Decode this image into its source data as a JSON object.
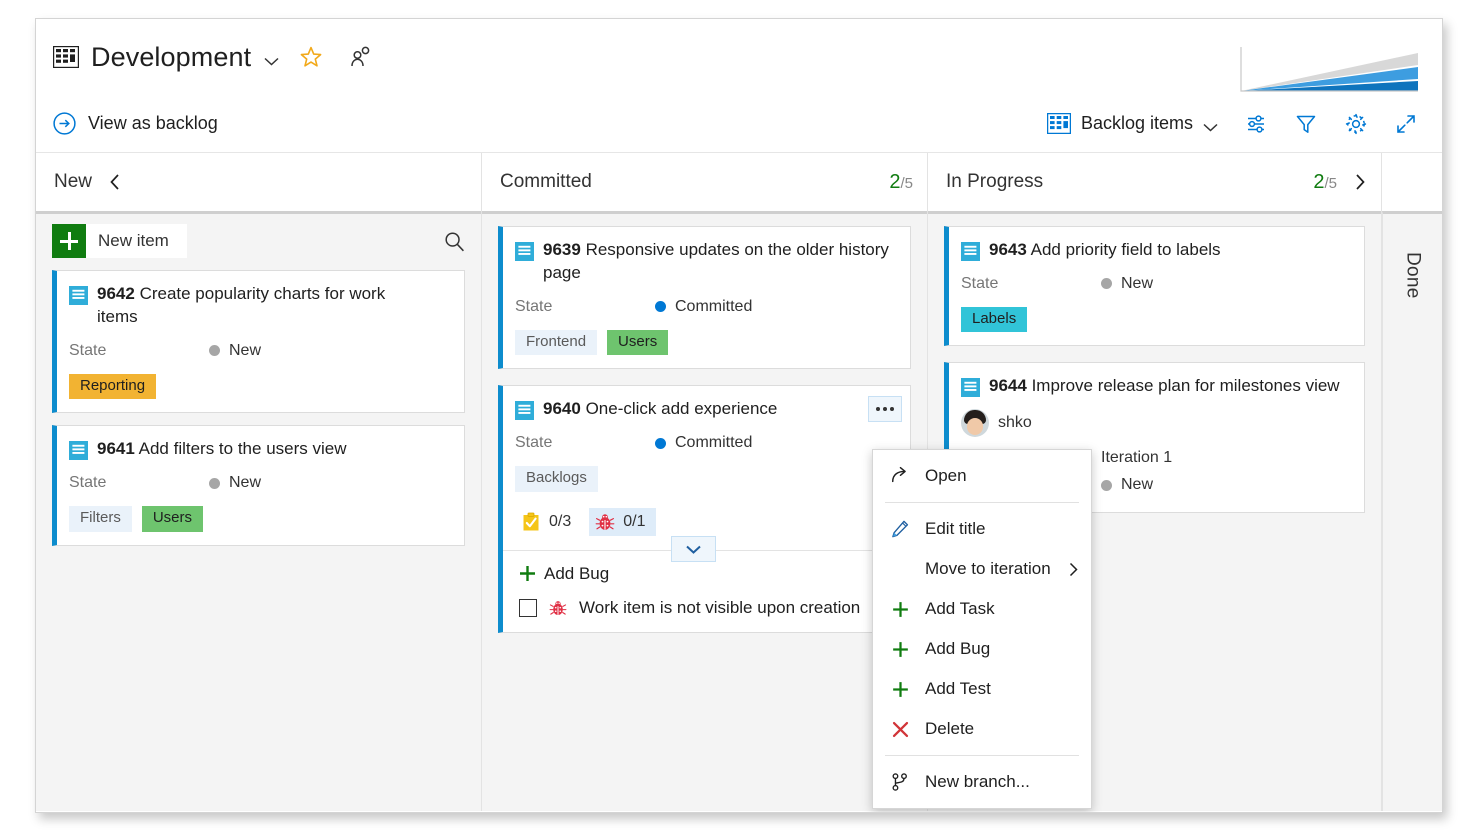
{
  "header": {
    "board_icon": "board-grid-icon",
    "title": "Development",
    "title_chevron": "chevron-down-icon",
    "favorite_icon": "star-icon",
    "team_icon": "people-icon",
    "chart_icon": "cumulative-flow-chart"
  },
  "toolbar": {
    "backlog_icon": "arrow-circle-right-icon",
    "backlog_label": "View as backlog",
    "picker_icon": "board-grid-icon",
    "picker_label": "Backlog items",
    "picker_chevron": "chevron-down-icon",
    "settings_sliders_icon": "sliders-icon",
    "filter_icon": "funnel-icon",
    "gear_icon": "gear-icon",
    "fullscreen_icon": "expand-diagonal-icon"
  },
  "board": {
    "new_item": {
      "label": "New item",
      "plus_icon": "plus-icon",
      "search_icon": "search-icon"
    },
    "columns": [
      {
        "name": "New",
        "count": "",
        "limit": "",
        "collapse_icon": "chevron-left-icon",
        "cards": [
          {
            "icon": "backlog-item-icon",
            "id": "9642",
            "title": "Create popularity charts for work items",
            "state_label": "State",
            "state_value": "New",
            "state_color": "#a6a6a6",
            "tags": [
              {
                "text": "Reporting",
                "bg": "#f2b332",
                "fg": "#1f1f1f"
              }
            ]
          },
          {
            "icon": "backlog-item-icon",
            "id": "9641",
            "title": "Add filters to the users view",
            "state_label": "State",
            "state_value": "New",
            "state_color": "#a6a6a6",
            "tags": [
              {
                "text": "Filters",
                "bg": "#eaf2fa",
                "fg": "#5a5a5a"
              },
              {
                "text": "Users",
                "bg": "#6ec46e",
                "fg": "#1f1f1f"
              }
            ]
          }
        ]
      },
      {
        "name": "Committed",
        "count": "2",
        "limit": "/5",
        "cards": [
          {
            "icon": "backlog-item-icon",
            "id": "9639",
            "title": "Responsive updates on the older history page",
            "state_label": "State",
            "state_value": "Committed",
            "state_color": "#0078d4",
            "tags": [
              {
                "text": "Frontend",
                "bg": "#eaf2fa",
                "fg": "#5a5a5a"
              },
              {
                "text": "Users",
                "bg": "#6ec46e",
                "fg": "#1f1f1f"
              }
            ]
          },
          {
            "icon": "backlog-item-icon",
            "id": "9640",
            "title": "One-click add experience",
            "state_label": "State",
            "state_value": "Committed",
            "state_color": "#0078d4",
            "menu_icon": "ellipsis-icon",
            "tags": [
              {
                "text": "Backlogs",
                "bg": "#eaf2fa",
                "fg": "#5a5a5a"
              }
            ],
            "counters": [
              {
                "icon": "task-checklist-icon",
                "value": "0/3",
                "highlight": false
              },
              {
                "icon": "bug-icon",
                "value": "0/1",
                "highlight": true
              }
            ],
            "expand_icon": "chevron-down-icon",
            "add_area": {
              "plus_icon": "plus-icon",
              "add_label": "Add Bug",
              "checkbox_icon": "checkbox-unchecked-icon",
              "bug_icon": "bug-icon",
              "checkbox_label": "Work item is not visible upon creation"
            }
          }
        ]
      },
      {
        "name": "In Progress",
        "count": "2",
        "limit": "/5",
        "expand_icon": "chevron-right-icon",
        "cards": [
          {
            "icon": "backlog-item-icon",
            "id": "9643",
            "title": "Add priority field to labels",
            "state_label": "State",
            "state_value": "New",
            "state_color": "#a6a6a6",
            "tags": [
              {
                "text": "Labels",
                "bg": "#31c4d8",
                "fg": "#1f1f1f"
              }
            ]
          },
          {
            "icon": "backlog-item-icon",
            "id": "9644",
            "title": "Improve release plan for milestones view",
            "avatar_icon": "avatar",
            "assignee": "shko",
            "iteration": "Iteration 1",
            "state_value": "New",
            "state_color": "#a6a6a6"
          }
        ]
      },
      {
        "name": "Done",
        "collapsed": true
      }
    ]
  },
  "context_menu": {
    "items": [
      {
        "icon": "open-arrow-icon",
        "label": "Open",
        "submenu": false
      },
      {
        "separator": true
      },
      {
        "icon": "pencil-icon",
        "label": "Edit title",
        "submenu": false
      },
      {
        "icon": "",
        "label": "Move to iteration",
        "submenu": true,
        "submenu_icon": "chevron-right-icon"
      },
      {
        "icon": "plus-icon",
        "label": "Add Task",
        "submenu": false
      },
      {
        "icon": "plus-icon",
        "label": "Add Bug",
        "submenu": false
      },
      {
        "icon": "plus-icon",
        "label": "Add Test",
        "submenu": false
      },
      {
        "icon": "close-x-icon",
        "label": "Delete",
        "submenu": false
      },
      {
        "separator": true
      },
      {
        "icon": "branch-icon",
        "label": "New branch...",
        "submenu": false
      }
    ]
  },
  "colors": {
    "accent": "#0078d4",
    "card_border_left": "#0d8ccd",
    "green": "#107c10",
    "red": "#d13438",
    "count_green": "#107c10"
  }
}
